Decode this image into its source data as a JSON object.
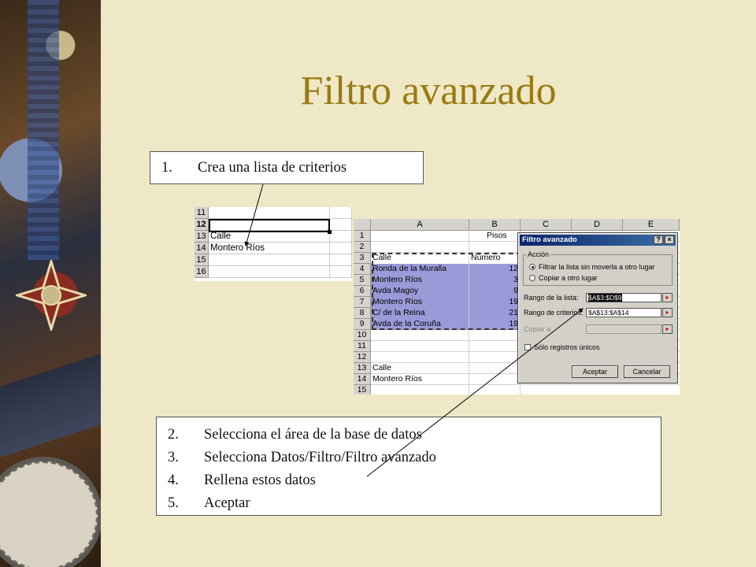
{
  "title": "Filtro avanzado",
  "callout_top": {
    "num": "1.",
    "text": "Crea una lista de criterios"
  },
  "steps": [
    {
      "num": "2.",
      "text": "Selecciona el área de la base de datos"
    },
    {
      "num": "3.",
      "text": "Selecciona Datos/Filtro/Filtro avanzado"
    },
    {
      "num": "4.",
      "text": "Rellena estos datos"
    },
    {
      "num": "5.",
      "text": "Aceptar"
    }
  ],
  "snippet": {
    "rows": [
      {
        "n": "11",
        "a": ""
      },
      {
        "n": "12",
        "a": ""
      },
      {
        "n": "13",
        "a": "Calle"
      },
      {
        "n": "14",
        "a": "Montero Ríos"
      },
      {
        "n": "15",
        "a": ""
      },
      {
        "n": "16",
        "a": ""
      }
    ]
  },
  "sheet": {
    "columns": [
      "A",
      "B",
      "C",
      "D",
      "E"
    ],
    "rows": [
      {
        "n": "1",
        "a": "",
        "b": "Pisos"
      },
      {
        "n": "2",
        "a": "",
        "b": ""
      },
      {
        "n": "3",
        "a": "Calle",
        "b": "Número"
      },
      {
        "n": "4",
        "a": "Ronda de la Muralla",
        "b": "12"
      },
      {
        "n": "5",
        "a": "Montero Ríos",
        "b": "3"
      },
      {
        "n": "6",
        "a": "Avda Magoy",
        "b": "9"
      },
      {
        "n": "7",
        "a": "Montero Ríos",
        "b": "19"
      },
      {
        "n": "8",
        "a": "C/ de la Reina",
        "b": "21"
      },
      {
        "n": "9",
        "a": "Avda de la Coruña",
        "b": "19"
      },
      {
        "n": "10",
        "a": "",
        "b": ""
      },
      {
        "n": "11",
        "a": "",
        "b": ""
      },
      {
        "n": "12",
        "a": "",
        "b": ""
      },
      {
        "n": "13",
        "a": "Calle",
        "b": ""
      },
      {
        "n": "14",
        "a": "Montero Ríos",
        "b": ""
      },
      {
        "n": "15",
        "a": "",
        "b": ""
      }
    ]
  },
  "dialog": {
    "title": "Filtro avanzado",
    "help_label": "?",
    "close_label": "×",
    "group_label": "Acción",
    "radio_1": "Filtrar la lista sin moverla a otro lugar",
    "radio_2": "Copiar a otro lugar",
    "list_range_label": "Rango de la lista:",
    "list_range_value": "$A$3:$D$9",
    "criteria_range_label": "Rango de criterios:",
    "criteria_range_value": "$A$13:$A$14",
    "copy_to_label": "Copiar a:",
    "copy_to_value": "",
    "unique_label": "Sólo registros únicos",
    "ok_label": "Aceptar",
    "cancel_label": "Cancelar"
  },
  "colors": {
    "title": "#9a7a12",
    "background": "#efe8c6",
    "selection": "#9a9ad8",
    "titlebar": "#0a246a"
  }
}
